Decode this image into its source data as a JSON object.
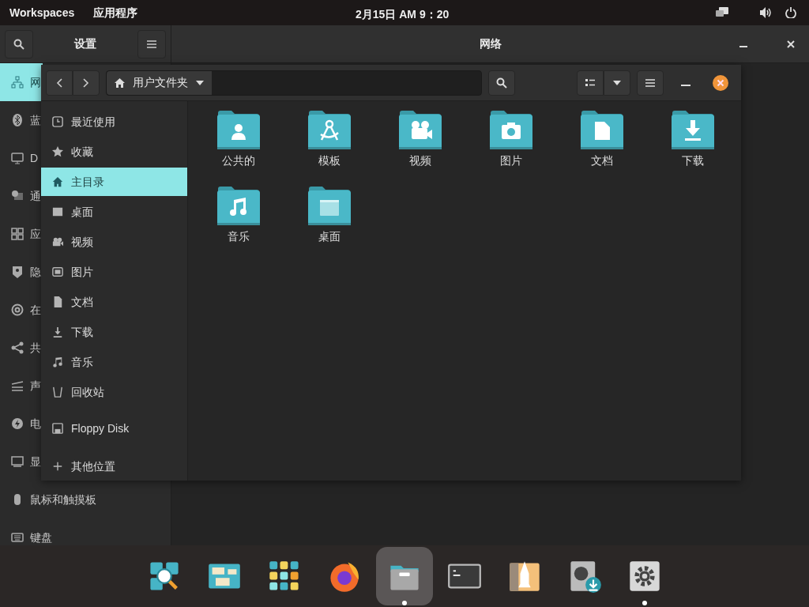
{
  "top_bar": {
    "workspaces": "Workspaces",
    "applications": "应用程序",
    "clock": "2月15日 AM 9：20"
  },
  "settings_window": {
    "title": "设置",
    "page_title": "网络",
    "sidebar": [
      {
        "label": "网",
        "selected": true
      },
      {
        "label": "蓝",
        "selected": false
      },
      {
        "label": "D",
        "selected": false
      },
      {
        "label": "通",
        "selected": false
      },
      {
        "label": "应",
        "selected": false
      },
      {
        "label": "隐",
        "selected": false
      },
      {
        "label": "在",
        "selected": false
      },
      {
        "label": "共",
        "selected": false
      },
      {
        "label": "声",
        "selected": false
      },
      {
        "label": "电",
        "selected": false
      },
      {
        "label": "显",
        "selected": false
      },
      {
        "label": "鼠标和触摸板",
        "selected": false
      },
      {
        "label": "键盘",
        "selected": false
      }
    ]
  },
  "files_window": {
    "path": "用户文件夹",
    "places": [
      {
        "label": "最近使用",
        "selected": false
      },
      {
        "label": "收藏",
        "selected": false
      },
      {
        "label": "主目录",
        "selected": true
      },
      {
        "label": "桌面",
        "selected": false
      },
      {
        "label": "视频",
        "selected": false
      },
      {
        "label": "图片",
        "selected": false
      },
      {
        "label": "文档",
        "selected": false
      },
      {
        "label": "下载",
        "selected": false
      },
      {
        "label": "音乐",
        "selected": false
      },
      {
        "label": "回收站",
        "selected": false
      }
    ],
    "devices": [
      {
        "label": "Floppy Disk"
      }
    ],
    "other": [
      {
        "label": "其他位置"
      }
    ],
    "folders": [
      {
        "name": "公共的"
      },
      {
        "name": "模板"
      },
      {
        "name": "视频"
      },
      {
        "name": "图片"
      },
      {
        "name": "文档"
      },
      {
        "name": "下载"
      },
      {
        "name": "音乐"
      },
      {
        "name": "桌面"
      }
    ]
  },
  "dock": [
    {
      "selected": false,
      "running": false
    },
    {
      "selected": false,
      "running": false
    },
    {
      "selected": false,
      "running": false
    },
    {
      "selected": false,
      "running": false
    },
    {
      "selected": true,
      "running": true
    },
    {
      "selected": false,
      "running": false
    },
    {
      "selected": false,
      "running": false
    },
    {
      "selected": false,
      "running": false
    },
    {
      "selected": false,
      "running": true
    }
  ]
}
